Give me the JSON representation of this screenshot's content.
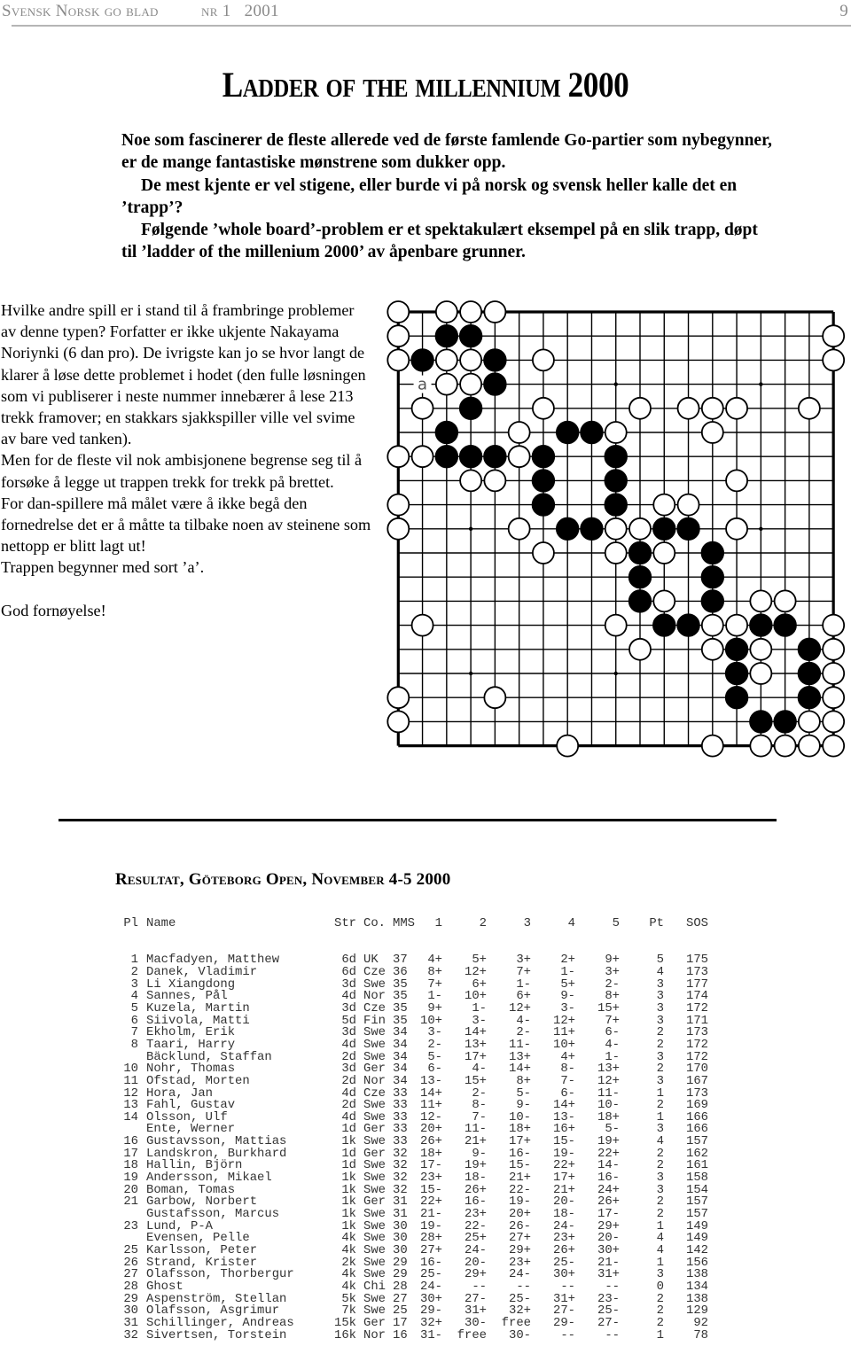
{
  "running_head": {
    "left": "Svensk Norsk go blad",
    "issue": "nr 1   2001",
    "page_number": "9"
  },
  "article": {
    "title": "Ladder of the millennium 2000",
    "intro_paragraphs": [
      "Noe som fascinerer de fleste allerede ved de første famlende Go-partier som nybegynner, er de mange fantastiske mønstrene som dukker opp.",
      "De mest kjente er vel stigene, eller burde  vi på norsk og svensk heller kalle det en ’trapp’?",
      "Følgende ’whole board’-problem er et  spektakulært eksempel på en slik trapp, døpt til ’ladder of the millenium 2000’ av åpenbare  grunner."
    ],
    "body_paragraphs": [
      "Hvilke andre spill er i stand til å frambringe problemer av denne typen? Forfatter er  ikke ukjente Nakayama Noriynki (6 dan pro). De ivrigste kan jo se hvor langt de klarer å løse dette problemet i hodet (den fulle løsningen som vi publiserer i neste nummer innebærer å lese 213 trekk framover; en stakkars sjakkspiller ville vel svime av bare ved tanken).",
      "Men for de fleste vil nok ambisjonene begrense seg til å forsøke å legge ut trappen trekk for  trekk på brettet.",
      "For dan-spillere må målet være å ikke begå den fornedrelse det er å måtte ta  tilbake noen av steinene som nettopp er blitt lagt ut!",
      "Trappen begynner med sort ’a’."
    ],
    "closing": "God fornøyelse!"
  },
  "go_board": {
    "size": 19,
    "colors": {
      "black": "#000000",
      "white": "#ffffff",
      "line": "#000000"
    },
    "label": {
      "text": "a",
      "row": 3,
      "col": 1
    },
    "star_points": [
      [
        3,
        3
      ],
      [
        3,
        9
      ],
      [
        3,
        15
      ],
      [
        9,
        3
      ],
      [
        9,
        9
      ],
      [
        9,
        15
      ],
      [
        15,
        3
      ],
      [
        15,
        9
      ],
      [
        15,
        15
      ]
    ],
    "black": [
      [
        1,
        2
      ],
      [
        1,
        3
      ],
      [
        2,
        1
      ],
      [
        2,
        4
      ],
      [
        3,
        4
      ],
      [
        4,
        3
      ],
      [
        5,
        2
      ],
      [
        5,
        7
      ],
      [
        5,
        8
      ],
      [
        6,
        2
      ],
      [
        6,
        3
      ],
      [
        6,
        4
      ],
      [
        6,
        6
      ],
      [
        6,
        9
      ],
      [
        7,
        6
      ],
      [
        7,
        9
      ],
      [
        8,
        6
      ],
      [
        8,
        9
      ],
      [
        9,
        7
      ],
      [
        9,
        8
      ],
      [
        9,
        11
      ],
      [
        9,
        12
      ],
      [
        10,
        10
      ],
      [
        10,
        13
      ],
      [
        11,
        10
      ],
      [
        11,
        13
      ],
      [
        12,
        10
      ],
      [
        12,
        13
      ],
      [
        13,
        11
      ],
      [
        13,
        12
      ],
      [
        13,
        15
      ],
      [
        13,
        16
      ],
      [
        14,
        14
      ],
      [
        14,
        17
      ],
      [
        15,
        14
      ],
      [
        15,
        17
      ],
      [
        16,
        14
      ],
      [
        16,
        17
      ],
      [
        17,
        15
      ],
      [
        17,
        16
      ]
    ],
    "white": [
      [
        0,
        0
      ],
      [
        0,
        2
      ],
      [
        0,
        3
      ],
      [
        0,
        4
      ],
      [
        1,
        0
      ],
      [
        1,
        18
      ],
      [
        2,
        0
      ],
      [
        2,
        2
      ],
      [
        2,
        3
      ],
      [
        2,
        6
      ],
      [
        2,
        18
      ],
      [
        3,
        2
      ],
      [
        3,
        3
      ],
      [
        4,
        1
      ],
      [
        4,
        6
      ],
      [
        4,
        10
      ],
      [
        4,
        12
      ],
      [
        4,
        13
      ],
      [
        4,
        14
      ],
      [
        4,
        17
      ],
      [
        5,
        5
      ],
      [
        5,
        9
      ],
      [
        5,
        13
      ],
      [
        6,
        0
      ],
      [
        6,
        1
      ],
      [
        6,
        5
      ],
      [
        7,
        3
      ],
      [
        7,
        4
      ],
      [
        7,
        14
      ],
      [
        8,
        0
      ],
      [
        8,
        11
      ],
      [
        8,
        12
      ],
      [
        9,
        0
      ],
      [
        9,
        5
      ],
      [
        9,
        9
      ],
      [
        9,
        10
      ],
      [
        9,
        14
      ],
      [
        10,
        6
      ],
      [
        10,
        9
      ],
      [
        10,
        11
      ],
      [
        12,
        11
      ],
      [
        12,
        15
      ],
      [
        12,
        16
      ],
      [
        13,
        1
      ],
      [
        13,
        9
      ],
      [
        13,
        13
      ],
      [
        13,
        14
      ],
      [
        13,
        18
      ],
      [
        14,
        10
      ],
      [
        14,
        13
      ],
      [
        14,
        15
      ],
      [
        14,
        18
      ],
      [
        15,
        15
      ],
      [
        15,
        18
      ],
      [
        16,
        0
      ],
      [
        16,
        4
      ],
      [
        16,
        18
      ],
      [
        17,
        0
      ],
      [
        17,
        17
      ],
      [
        17,
        18
      ],
      [
        18,
        7
      ],
      [
        18,
        13
      ],
      [
        18,
        15
      ],
      [
        18,
        16
      ],
      [
        18,
        17
      ],
      [
        18,
        18
      ]
    ]
  },
  "results": {
    "title": "Resultat, Göteborg Open, November 4-5 2000",
    "headers": {
      "pl": "Pl",
      "name": "Name",
      "str": "Str",
      "co": "Co.",
      "mms": "MMS",
      "r1": "1",
      "r2": "2",
      "r3": "3",
      "r4": "4",
      "r5": "5",
      "pt": "Pt",
      "sos": "SOS"
    },
    "rows": [
      {
        "pl": "1",
        "name": "Macfadyen, Matthew",
        "str": "6d",
        "co": "UK",
        "mms": "37",
        "rounds": [
          "4+",
          "5+",
          "3+",
          "2+",
          "9+"
        ],
        "pt": "5",
        "sos": "175"
      },
      {
        "pl": "2",
        "name": "Danek, Vladimir",
        "str": "6d",
        "co": "Cze",
        "mms": "36",
        "rounds": [
          "8+",
          "12+",
          "7+",
          "1-",
          "3+"
        ],
        "pt": "4",
        "sos": "173"
      },
      {
        "pl": "3",
        "name": "Li Xiangdong",
        "str": "3d",
        "co": "Swe",
        "mms": "35",
        "rounds": [
          "7+",
          "6+",
          "1-",
          "5+",
          "2-"
        ],
        "pt": "3",
        "sos": "177"
      },
      {
        "pl": "4",
        "name": "Sannes, Pål",
        "str": "4d",
        "co": "Nor",
        "mms": "35",
        "rounds": [
          "1-",
          "10+",
          "6+",
          "9-",
          "8+"
        ],
        "pt": "3",
        "sos": "174"
      },
      {
        "pl": "5",
        "name": "Kuzela, Martin",
        "str": "3d",
        "co": "Cze",
        "mms": "35",
        "rounds": [
          "9+",
          "1-",
          "12+",
          "3-",
          "15+"
        ],
        "pt": "3",
        "sos": "172"
      },
      {
        "pl": "6",
        "name": "Siivola, Matti",
        "str": "5d",
        "co": "Fin",
        "mms": "35",
        "rounds": [
          "10+",
          "3-",
          "4-",
          "12+",
          "7+"
        ],
        "pt": "3",
        "sos": "171"
      },
      {
        "pl": "7",
        "name": "Ekholm, Erik",
        "str": "3d",
        "co": "Swe",
        "mms": "34",
        "rounds": [
          "3-",
          "14+",
          "2-",
          "11+",
          "6-"
        ],
        "pt": "2",
        "sos": "173"
      },
      {
        "pl": "8",
        "name": "Taari, Harry",
        "str": "4d",
        "co": "Swe",
        "mms": "34",
        "rounds": [
          "2-",
          "13+",
          "11-",
          "10+",
          "4-"
        ],
        "pt": "2",
        "sos": "172"
      },
      {
        "pl": "",
        "name": "Bäcklund, Staffan",
        "str": "2d",
        "co": "Swe",
        "mms": "34",
        "rounds": [
          "5-",
          "17+",
          "13+",
          "4+",
          "1-"
        ],
        "pt": "3",
        "sos": "172"
      },
      {
        "pl": "10",
        "name": "Nohr, Thomas",
        "str": "3d",
        "co": "Ger",
        "mms": "34",
        "rounds": [
          "6-",
          "4-",
          "14+",
          "8-",
          "13+"
        ],
        "pt": "2",
        "sos": "170"
      },
      {
        "pl": "11",
        "name": "Ofstad, Morten",
        "str": "2d",
        "co": "Nor",
        "mms": "34",
        "rounds": [
          "13-",
          "15+",
          "8+",
          "7-",
          "12+"
        ],
        "pt": "3",
        "sos": "167"
      },
      {
        "pl": "12",
        "name": "Hora, Jan",
        "str": "4d",
        "co": "Cze",
        "mms": "33",
        "rounds": [
          "14+",
          "2-",
          "5-",
          "6-",
          "11-"
        ],
        "pt": "1",
        "sos": "173"
      },
      {
        "pl": "13",
        "name": "Fahl, Gustav",
        "str": "2d",
        "co": "Swe",
        "mms": "33",
        "rounds": [
          "11+",
          "8-",
          "9-",
          "14+",
          "10-"
        ],
        "pt": "2",
        "sos": "169"
      },
      {
        "pl": "14",
        "name": "Olsson, Ulf",
        "str": "4d",
        "co": "Swe",
        "mms": "33",
        "rounds": [
          "12-",
          "7-",
          "10-",
          "13-",
          "18+"
        ],
        "pt": "1",
        "sos": "166"
      },
      {
        "pl": "",
        "name": "Ente, Werner",
        "str": "1d",
        "co": "Ger",
        "mms": "33",
        "rounds": [
          "20+",
          "11-",
          "18+",
          "16+",
          "5-"
        ],
        "pt": "3",
        "sos": "166"
      },
      {
        "pl": "16",
        "name": "Gustavsson, Mattias",
        "str": "1k",
        "co": "Swe",
        "mms": "33",
        "rounds": [
          "26+",
          "21+",
          "17+",
          "15-",
          "19+"
        ],
        "pt": "4",
        "sos": "157"
      },
      {
        "pl": "17",
        "name": "Landskron, Burkhard",
        "str": "1d",
        "co": "Ger",
        "mms": "32",
        "rounds": [
          "18+",
          "9-",
          "16-",
          "19-",
          "22+"
        ],
        "pt": "2",
        "sos": "162"
      },
      {
        "pl": "18",
        "name": "Hallin, Björn",
        "str": "1d",
        "co": "Swe",
        "mms": "32",
        "rounds": [
          "17-",
          "19+",
          "15-",
          "22+",
          "14-"
        ],
        "pt": "2",
        "sos": "161"
      },
      {
        "pl": "19",
        "name": "Andersson, Mikael",
        "str": "1k",
        "co": "Swe",
        "mms": "32",
        "rounds": [
          "23+",
          "18-",
          "21+",
          "17+",
          "16-"
        ],
        "pt": "3",
        "sos": "158"
      },
      {
        "pl": "20",
        "name": "Boman, Tomas",
        "str": "1k",
        "co": "Swe",
        "mms": "32",
        "rounds": [
          "15-",
          "26+",
          "22-",
          "21+",
          "24+"
        ],
        "pt": "3",
        "sos": "154"
      },
      {
        "pl": "21",
        "name": "Garbow, Norbert",
        "str": "1k",
        "co": "Ger",
        "mms": "31",
        "rounds": [
          "22+",
          "16-",
          "19-",
          "20-",
          "26+"
        ],
        "pt": "2",
        "sos": "157"
      },
      {
        "pl": "",
        "name": "Gustafsson, Marcus",
        "str": "1k",
        "co": "Swe",
        "mms": "31",
        "rounds": [
          "21-",
          "23+",
          "20+",
          "18-",
          "17-"
        ],
        "pt": "2",
        "sos": "157"
      },
      {
        "pl": "23",
        "name": "Lund, P-A",
        "str": "1k",
        "co": "Swe",
        "mms": "30",
        "rounds": [
          "19-",
          "22-",
          "26-",
          "24-",
          "29+"
        ],
        "pt": "1",
        "sos": "149"
      },
      {
        "pl": "",
        "name": "Evensen, Pelle",
        "str": "4k",
        "co": "Swe",
        "mms": "30",
        "rounds": [
          "28+",
          "25+",
          "27+",
          "23+",
          "20-"
        ],
        "pt": "4",
        "sos": "149"
      },
      {
        "pl": "25",
        "name": "Karlsson, Peter",
        "str": "4k",
        "co": "Swe",
        "mms": "30",
        "rounds": [
          "27+",
          "24-",
          "29+",
          "26+",
          "30+"
        ],
        "pt": "4",
        "sos": "142"
      },
      {
        "pl": "26",
        "name": "Strand, Krister",
        "str": "2k",
        "co": "Swe",
        "mms": "29",
        "rounds": [
          "16-",
          "20-",
          "23+",
          "25-",
          "21-"
        ],
        "pt": "1",
        "sos": "156"
      },
      {
        "pl": "27",
        "name": "Olafsson, Thorbergur",
        "str": "4k",
        "co": "Swe",
        "mms": "29",
        "rounds": [
          "25-",
          "29+",
          "24-",
          "30+",
          "31+"
        ],
        "pt": "3",
        "sos": "138"
      },
      {
        "pl": "28",
        "name": "Ghost",
        "str": "4k",
        "co": "Chi",
        "mms": "28",
        "rounds": [
          "24-",
          "--",
          "--",
          "--",
          "--"
        ],
        "pt": "0",
        "sos": "134"
      },
      {
        "pl": "29",
        "name": "Aspenström, Stellan",
        "str": "5k",
        "co": "Swe",
        "mms": "27",
        "rounds": [
          "30+",
          "27-",
          "25-",
          "31+",
          "23-"
        ],
        "pt": "2",
        "sos": "138"
      },
      {
        "pl": "30",
        "name": "Olafsson, Asgrimur",
        "str": "7k",
        "co": "Swe",
        "mms": "25",
        "rounds": [
          "29-",
          "31+",
          "32+",
          "27-",
          "25-"
        ],
        "pt": "2",
        "sos": "129"
      },
      {
        "pl": "31",
        "name": "Schillinger, Andreas",
        "str": "15k",
        "co": "Ger",
        "mms": "17",
        "rounds": [
          "32+",
          "30-",
          "free",
          "29-",
          "27-"
        ],
        "pt": "2",
        "sos": "92"
      },
      {
        "pl": "32",
        "name": "Sivertsen, Torstein",
        "str": "16k",
        "co": "Nor",
        "mms": "16",
        "rounds": [
          "31-",
          "free",
          "30-",
          "--",
          "--"
        ],
        "pt": "1",
        "sos": "78"
      }
    ]
  }
}
